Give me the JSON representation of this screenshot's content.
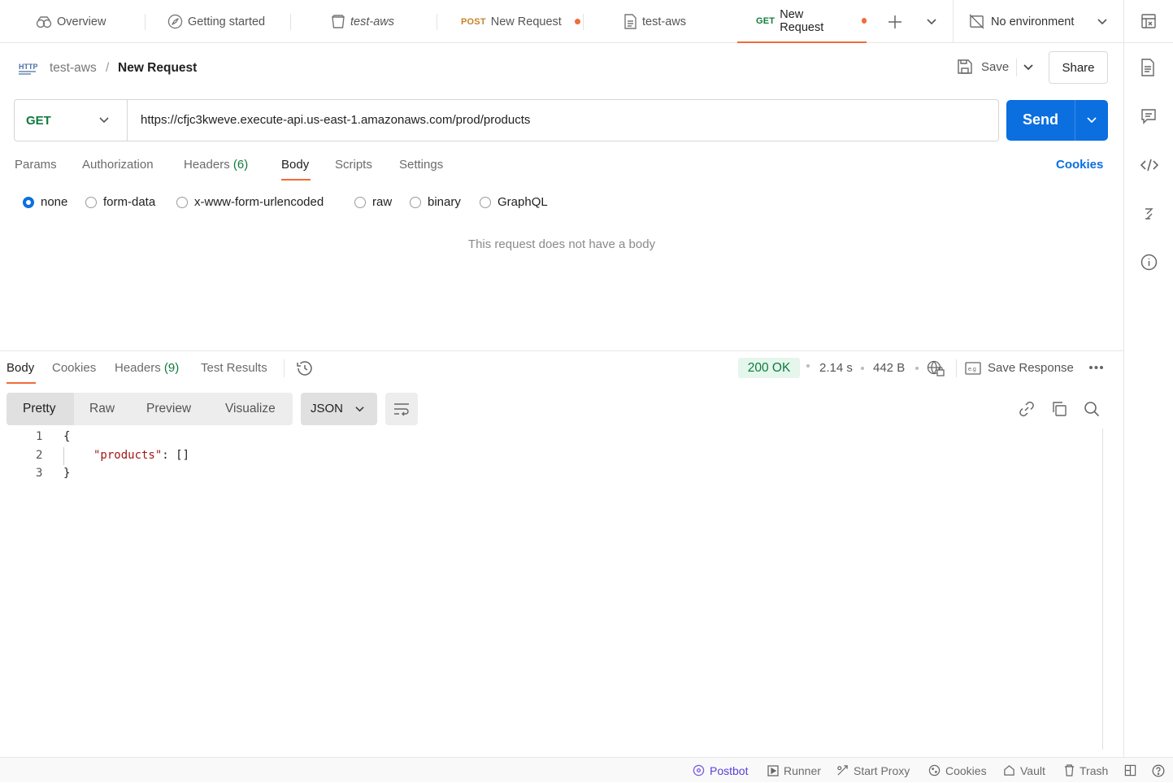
{
  "tabs": [
    {
      "label": "Overview",
      "icon": "overview-icon"
    },
    {
      "label": "Getting started",
      "icon": "rocket-icon"
    },
    {
      "label": "test-aws",
      "icon": "collection-icon"
    },
    {
      "method": "POST",
      "label": "New Request",
      "unsaved": true
    },
    {
      "label": "test-aws",
      "icon": "document-icon"
    },
    {
      "method": "GET",
      "label": "New Request",
      "unsaved": true,
      "active": true
    }
  ],
  "environment": {
    "label": "No environment"
  },
  "breadcrumb": {
    "badge": "HTTP",
    "parent": "test-aws",
    "separator": "/",
    "current": "New Request"
  },
  "actions": {
    "save": "Save",
    "share": "Share"
  },
  "request": {
    "method": "GET",
    "url": "https://cfjc3kweve.execute-api.us-east-1.amazonaws.com/prod/products",
    "send": "Send"
  },
  "request_tabs": {
    "params": "Params",
    "authorization": "Authorization",
    "headers": "Headers",
    "headers_count": "(6)",
    "body": "Body",
    "scripts": "Scripts",
    "settings": "Settings",
    "cookies": "Cookies"
  },
  "body_types": [
    "none",
    "form-data",
    "x-www-form-urlencoded",
    "raw",
    "binary",
    "GraphQL"
  ],
  "body_selected": "none",
  "empty_body_message": "This request does not have a body",
  "response_tabs": {
    "body": "Body",
    "cookies": "Cookies",
    "headers": "Headers",
    "headers_count": "(9)",
    "test_results": "Test Results"
  },
  "response_meta": {
    "status": "200 OK",
    "time": "2.14 s",
    "size": "442 B",
    "save_response": "Save Response"
  },
  "view_modes": [
    "Pretty",
    "Raw",
    "Preview",
    "Visualize"
  ],
  "view_selected": "Pretty",
  "format": "JSON",
  "code_lines": [
    {
      "num": "1",
      "text": "{"
    },
    {
      "num": "2",
      "key": "\"products\"",
      "rest": ": []"
    },
    {
      "num": "3",
      "text": "}"
    }
  ],
  "footer": {
    "postbot": "Postbot",
    "runner": "Runner",
    "start_proxy": "Start Proxy",
    "cookies": "Cookies",
    "vault": "Vault",
    "trash": "Trash"
  },
  "colors": {
    "accent": "#0b6fe0",
    "active_tab_underline": "#f26b3a",
    "status_ok": "#0f7b3d",
    "status_ok_bg": "#e5f6ec",
    "post_method": "#c9822b",
    "get_method": "#0f7b3d"
  }
}
